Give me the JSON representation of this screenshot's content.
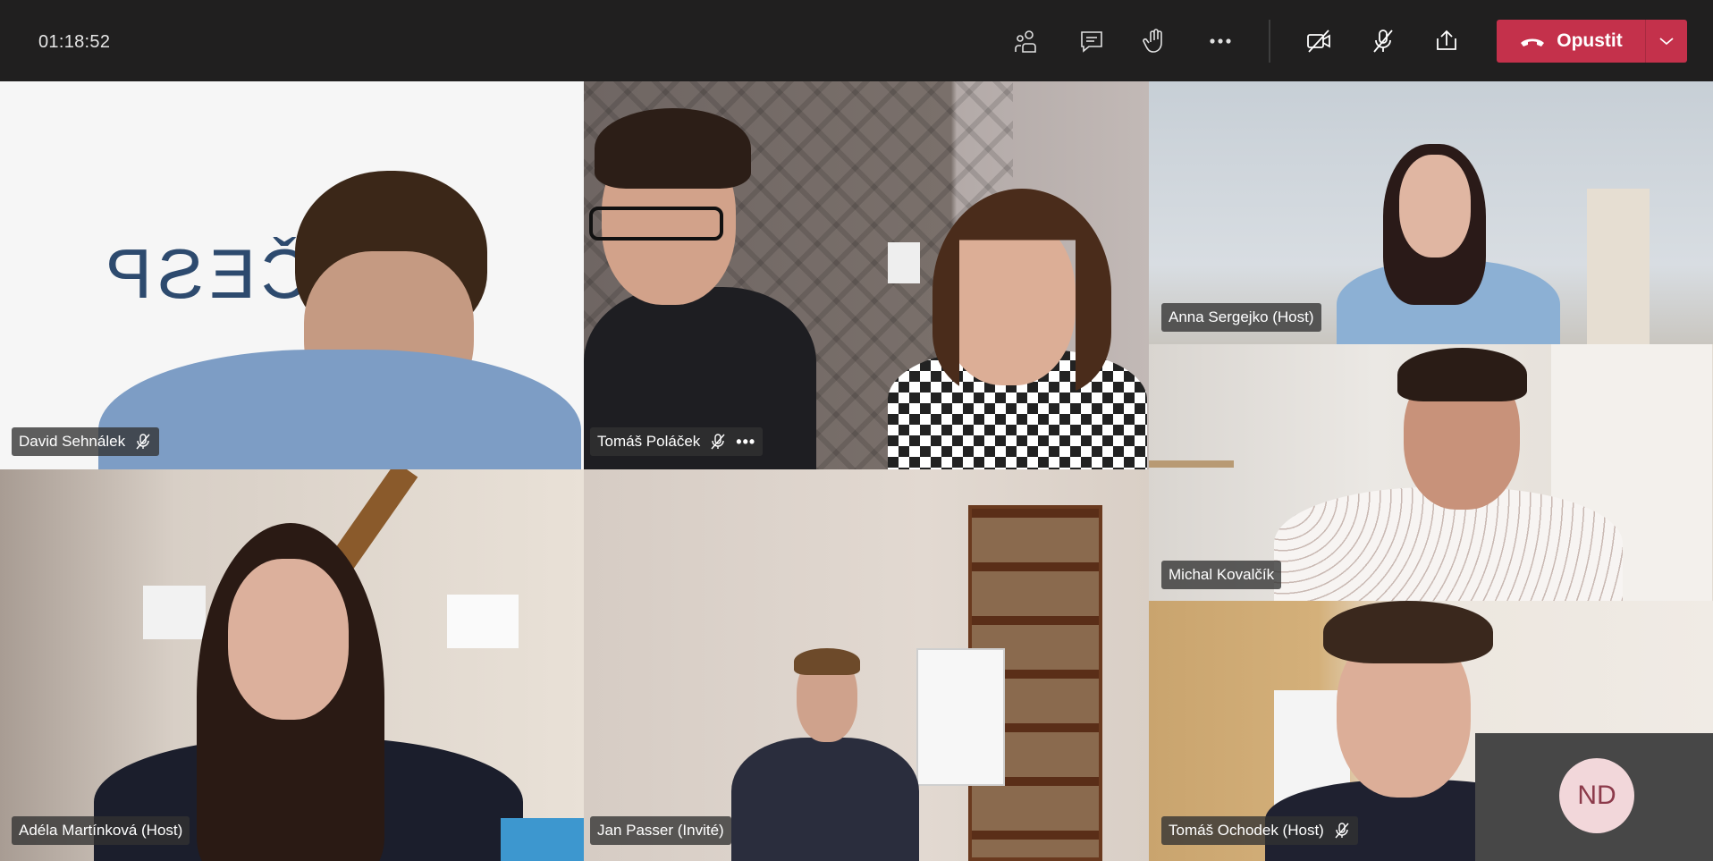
{
  "toolbar": {
    "timer": "01:18:52",
    "icons": [
      "participants-icon",
      "chat-icon",
      "raise-hand-icon",
      "more-actions-icon",
      "camera-off-icon",
      "mic-off-icon",
      "share-screen-icon"
    ],
    "leave_label": "Opustit",
    "leave_color": "#c4314b"
  },
  "participants": [
    {
      "name": "David Sehnálek",
      "muted": true
    },
    {
      "name": "Tomáš Poláček",
      "muted": true,
      "more": "•••"
    },
    {
      "name": "Anna Sergejko (Host)",
      "muted": false
    },
    {
      "name": "Michal Kovalčík",
      "muted": false
    },
    {
      "name": "Adéla Martínková (Host)",
      "muted": false
    },
    {
      "name": "Jan Passer (Invité)",
      "muted": false
    },
    {
      "name": "Tomáš Ochodek (Host)",
      "muted": true
    }
  ],
  "self_view": {
    "initials": "ND"
  },
  "backdrop_text": "ČESP"
}
